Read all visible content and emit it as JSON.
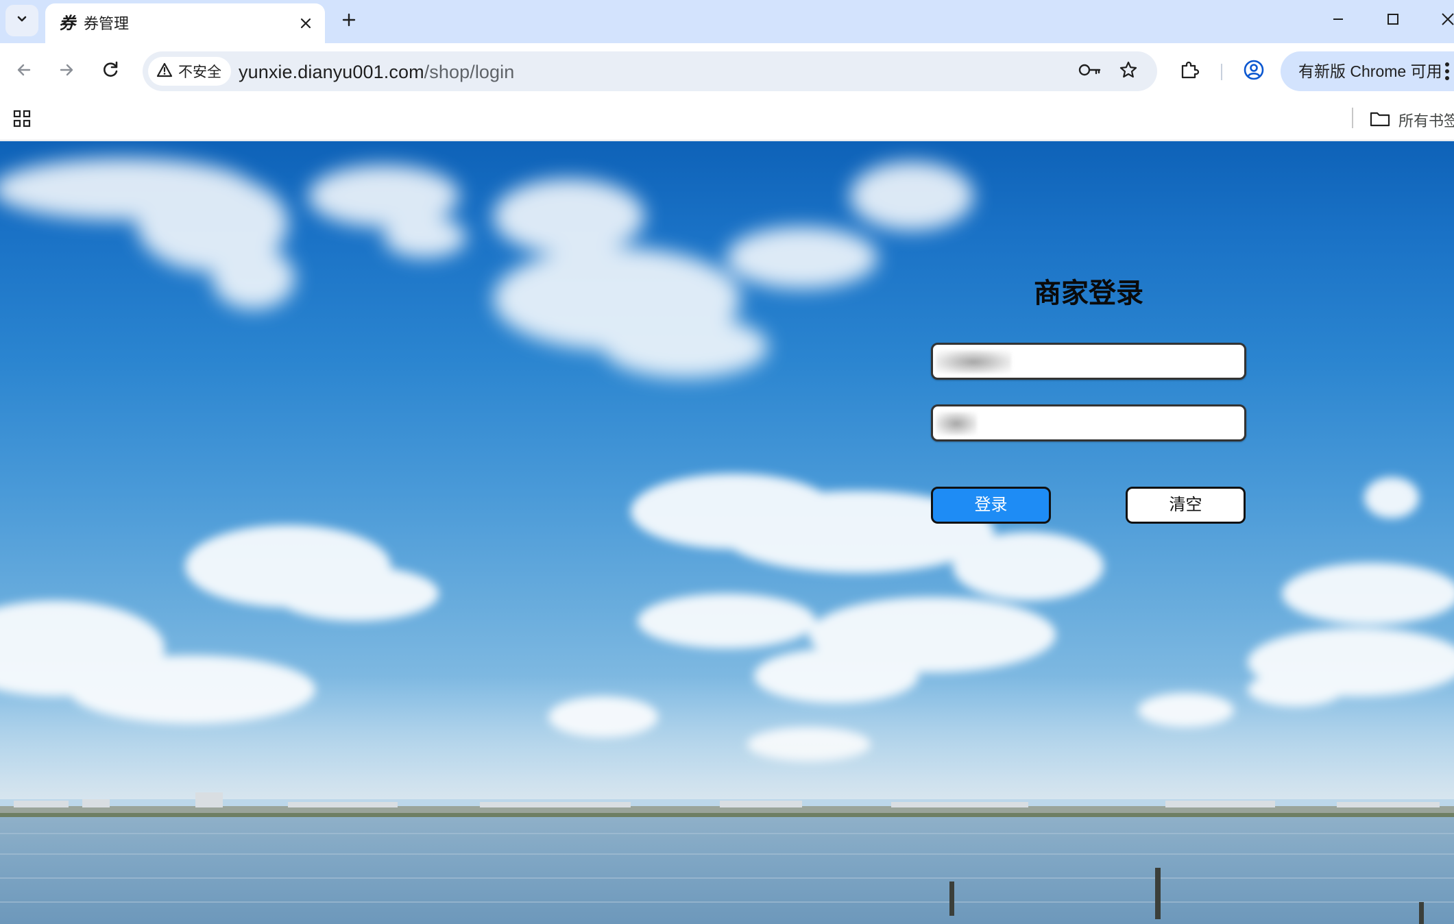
{
  "browser": {
    "tab": {
      "title": "券管理",
      "favicon_glyph": "券"
    },
    "omnibox": {
      "security_label": "不安全",
      "url_host": "yunxie.dianyu001.com",
      "url_path": "/shop/login"
    },
    "update_chip_label": "有新版 Chrome 可用",
    "bookmarks": {
      "all_bookmarks_label": "所有书签"
    },
    "icons": {
      "tab_list": "chevron-down-icon",
      "tab_close": "close-icon",
      "new_tab": "plus-icon",
      "minimize": "minimize-icon",
      "maximize": "maximize-icon",
      "close_window": "close-icon",
      "back": "arrow-left-icon",
      "forward": "arrow-right-icon",
      "reload": "reload-icon",
      "security": "warning-icon",
      "passwords": "key-icon",
      "bookmark": "star-icon",
      "extensions": "puzzle-icon",
      "profile": "profile-icon",
      "menu": "more-vert-icon",
      "apps": "apps-grid-icon",
      "folder": "folder-icon"
    }
  },
  "login": {
    "title": "商家登录",
    "username": {
      "value": "",
      "masked": true
    },
    "password": {
      "value": "",
      "masked": true
    },
    "login_button": "登录",
    "clear_button": "清空"
  },
  "colors": {
    "tabstrip_bg": "#d3e3fd",
    "omnibox_bg": "#e9eef6",
    "login_button_bg": "#1e8cf5",
    "sky_top": "#0e62b8",
    "water": "#7fa6c4"
  }
}
